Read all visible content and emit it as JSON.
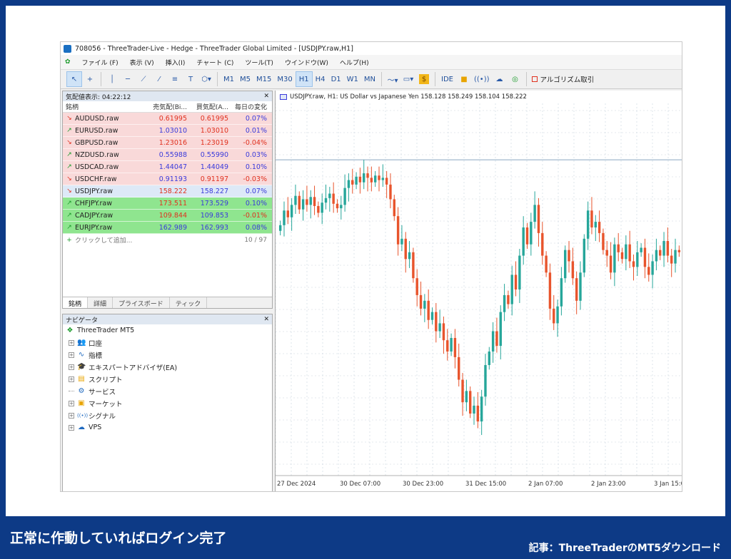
{
  "window": {
    "title": "708056 - ThreeTrader-Live - Hedge - ThreeTrader Global Limited - [USDJPY.raw,H1]"
  },
  "menu": [
    "ファイル (F)",
    "表示 (V)",
    "挿入(I)",
    "チャート (C)",
    "ツール(T)",
    "ウインドウ(W)",
    "ヘルプ(H)"
  ],
  "toolbar": {
    "timeframes": [
      "M1",
      "M5",
      "M15",
      "M30",
      "H1",
      "H4",
      "D1",
      "W1",
      "MN"
    ],
    "selected_timeframe": "H1",
    "ide_label": "IDE",
    "algo_label": "アルゴリズム取引"
  },
  "market_watch": {
    "header": "気配値表示: 04:22:12",
    "columns": [
      "銘柄",
      "売気配(Bi...",
      "買気配(A...",
      "毎日の変化"
    ],
    "rows": [
      {
        "symbol": "AUDUSD.raw",
        "bid": "0.61995",
        "ask": "0.61995",
        "change": "0.07%",
        "dir": "down",
        "bg": "#f9d9d9",
        "bid_color": "#e0301e",
        "ask_color": "#e0301e",
        "chg_color": "#3a3adb"
      },
      {
        "symbol": "EURUSD.raw",
        "bid": "1.03010",
        "ask": "1.03010",
        "change": "0.01%",
        "dir": "up",
        "bg": "#f9d9d9",
        "bid_color": "#3a3adb",
        "ask_color": "#e0301e",
        "chg_color": "#3a3adb"
      },
      {
        "symbol": "GBPUSD.raw",
        "bid": "1.23016",
        "ask": "1.23019",
        "change": "-0.04%",
        "dir": "down",
        "bg": "#f9d9d9",
        "bid_color": "#e0301e",
        "ask_color": "#e0301e",
        "chg_color": "#e0301e"
      },
      {
        "symbol": "NZDUSD.raw",
        "bid": "0.55988",
        "ask": "0.55990",
        "change": "0.03%",
        "dir": "up",
        "bg": "#f9d9d9",
        "bid_color": "#3a3adb",
        "ask_color": "#3a3adb",
        "chg_color": "#3a3adb"
      },
      {
        "symbol": "USDCAD.raw",
        "bid": "1.44047",
        "ask": "1.44049",
        "change": "0.10%",
        "dir": "up",
        "bg": "#f9d9d9",
        "bid_color": "#3a3adb",
        "ask_color": "#3a3adb",
        "chg_color": "#3a3adb"
      },
      {
        "symbol": "USDCHF.raw",
        "bid": "0.91193",
        "ask": "0.91197",
        "change": "-0.03%",
        "dir": "down",
        "bg": "#f9d9d9",
        "bid_color": "#3a3adb",
        "ask_color": "#e0301e",
        "chg_color": "#e0301e"
      },
      {
        "symbol": "USDJPY.raw",
        "bid": "158.222",
        "ask": "158.227",
        "change": "0.07%",
        "dir": "down",
        "bg": "#dde9f7",
        "bid_color": "#e0301e",
        "ask_color": "#3a3adb",
        "chg_color": "#3a3adb"
      },
      {
        "symbol": "CHFJPY.raw",
        "bid": "173.511",
        "ask": "173.529",
        "change": "0.10%",
        "dir": "up",
        "bg": "#8fe58f",
        "bid_color": "#e0301e",
        "ask_color": "#3a3adb",
        "chg_color": "#3a3adb"
      },
      {
        "symbol": "CADJPY.raw",
        "bid": "109.844",
        "ask": "109.853",
        "change": "-0.01%",
        "dir": "up",
        "bg": "#8fe58f",
        "bid_color": "#e0301e",
        "ask_color": "#3a3adb",
        "chg_color": "#e0301e"
      },
      {
        "symbol": "EURJPY.raw",
        "bid": "162.989",
        "ask": "162.993",
        "change": "0.08%",
        "dir": "up",
        "bg": "#8fe58f",
        "bid_color": "#3a3adb",
        "ask_color": "#3a3adb",
        "chg_color": "#3a3adb"
      }
    ],
    "add_label": "クリックして追加...",
    "count": "10 / 97",
    "tabs": [
      "銘柄",
      "詳細",
      "プライスボード",
      "ティック"
    ]
  },
  "navigator": {
    "header": "ナビゲータ",
    "root": "ThreeTrader MT5",
    "items": [
      {
        "label": "口座",
        "icon": "accounts-icon"
      },
      {
        "label": "指標",
        "icon": "indicators-icon"
      },
      {
        "label": "エキスパートアドバイザ(EA)",
        "icon": "expert-advisor-icon"
      },
      {
        "label": "スクリプト",
        "icon": "scripts-icon"
      },
      {
        "label": "サービス",
        "icon": "services-icon"
      },
      {
        "label": "マーケット",
        "icon": "market-icon"
      },
      {
        "label": "シグナル",
        "icon": "signals-icon"
      },
      {
        "label": "VPS",
        "icon": "vps-icon"
      }
    ]
  },
  "chart_data": {
    "type": "candlestick",
    "info": "USDJPY.raw, H1:  US Dollar vs Japanese Yen  158.128 158.249 158.104 158.222",
    "x_labels": [
      "27 Dec 2024",
      "30 Dec 07:00",
      "30 Dec 23:00",
      "31 Dec 15:00",
      "2 Jan 07:00",
      "2 Jan 23:00",
      "3 Jan 15:00"
    ],
    "close_series": [
      157.72,
      157.85,
      157.79,
      157.9,
      157.98,
      157.86,
      157.95,
      157.9,
      157.97,
      157.89,
      157.83,
      157.92,
      157.96,
      158.0,
      157.91,
      157.87,
      157.9,
      158.05,
      158.12,
      158.08,
      158.15,
      158.1,
      158.18,
      158.14,
      158.1,
      158.16,
      158.12,
      158.14,
      158.08,
      157.95,
      157.8,
      157.55,
      157.6,
      157.42,
      157.48,
      157.25,
      157.1,
      156.98,
      157.05,
      156.88,
      156.95,
      156.78,
      156.85,
      156.7,
      156.6,
      156.72,
      156.55,
      156.35,
      156.15,
      156.25,
      156.05,
      156.12,
      155.98,
      156.2,
      156.48,
      156.6,
      156.78,
      156.65,
      156.95,
      157.1,
      157.02,
      157.28,
      157.15,
      157.45,
      157.7,
      157.55,
      157.75,
      157.9,
      157.65,
      157.45,
      157.3,
      156.98,
      156.85,
      157.0,
      157.25,
      157.5,
      157.4,
      157.25,
      157.05,
      157.3,
      157.6,
      157.85,
      157.7,
      157.75,
      157.65,
      157.5,
      157.45,
      157.3,
      157.55,
      157.48,
      157.42,
      157.55,
      157.4,
      157.35,
      157.48,
      157.52,
      157.35,
      157.28,
      157.4,
      157.5,
      157.45,
      157.58,
      157.45,
      157.38,
      157.5,
      157.48
    ],
    "y_range": [
      155.5,
      158.8
    ],
    "price_line": 158.3,
    "up_color": "#26a69a",
    "down_color": "#e8542c",
    "grid": true
  },
  "caption": "正常に作動していればログイン完了",
  "source": "記事：ThreeTraderのMT5ダウンロード"
}
